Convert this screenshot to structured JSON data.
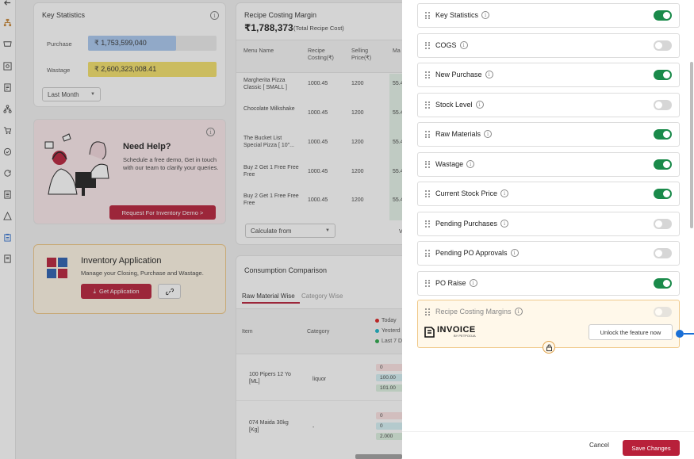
{
  "colors": {
    "brand_red": "#b8203a",
    "toggle_on": "#1a8a4a",
    "toggle_off": "#d6d6d6",
    "purchase_bar": "#a9c8f0",
    "wastage_bar": "#f4e06a"
  },
  "rail_icons": [
    "back-arrow-icon",
    "hierarchy-icon",
    "store-icon",
    "dollar-box-icon",
    "report-icon",
    "org-chart-icon",
    "cart-icon",
    "check-circle-icon",
    "refresh-icon",
    "ledger-icon",
    "warning-icon",
    "clipboard-icon",
    "document-icon"
  ],
  "key_statistics": {
    "title": "Key Statistics",
    "purchase_label": "Purchase",
    "purchase_value": "₹ 1,753,599,040",
    "wastage_label": "Wastage",
    "wastage_value": "₹ 2,600,323,008.41",
    "period_select": "Last Month"
  },
  "recipe_costing": {
    "title": "Recipe Costing Margin",
    "total": "₹1,788,373",
    "total_note": "(Total Recipe Cost)",
    "columns": [
      "Menu Name",
      "Recipe Costing(₹)",
      "Selling Price(₹)",
      "Ma"
    ],
    "rows": [
      {
        "name": "Margherita Pizza Classic [ SMALL ]",
        "cost": "1000.45",
        "price": "1200",
        "margin": "55.4"
      },
      {
        "name": "Chocolate Milkshake",
        "cost": "1000.45",
        "price": "1200",
        "margin": "55.4"
      },
      {
        "name": "The Bucket List Special Pizza [ 10\"...",
        "cost": "1000.45",
        "price": "1200",
        "margin": "55.4"
      },
      {
        "name": "Buy 2 Get 1 Free Free Free",
        "cost": "1000.45",
        "price": "1200",
        "margin": "55.4"
      },
      {
        "name": "Buy 2 Get 1 Free Free Free",
        "cost": "1000.45",
        "price": "1200",
        "margin": "55.4"
      }
    ],
    "calculate_select": "Calculate from",
    "cut_text": "V"
  },
  "help": {
    "title": "Need Help?",
    "text": "Schedule a free demo, Get in touch with our team to clarify your queries.",
    "button": "Request For Inventory Demo >"
  },
  "inventory_app": {
    "title": "Inventory Application",
    "text": "Manage your Closing, Purchase and Wastage.",
    "button": "Get Application"
  },
  "consumption": {
    "title": "Consumption Comparison",
    "tabs": [
      "Raw Material Wise",
      "Category Wise"
    ],
    "columns": [
      "Item",
      "Category"
    ],
    "legend": [
      "Today",
      "Yesterd",
      "Last 7 D"
    ],
    "rows": [
      {
        "item": "100 Pipers 12 Yo [ML]",
        "category": "liquor",
        "vals": [
          "0",
          "100.00",
          "101.00"
        ]
      },
      {
        "item": "074 Maida 30kg [Kg]",
        "category": "-",
        "vals": [
          "0",
          "0",
          "2.000"
        ]
      }
    ]
  },
  "drawer": {
    "widgets": [
      {
        "label": "Key Statistics",
        "on": true
      },
      {
        "label": "COGS",
        "on": false
      },
      {
        "label": "New Purchase",
        "on": true
      },
      {
        "label": "Stock Level",
        "on": false
      },
      {
        "label": "Raw Materials",
        "on": true
      },
      {
        "label": "Wastage",
        "on": true
      },
      {
        "label": "Current Stock Price",
        "on": true
      },
      {
        "label": "Pending Purchases",
        "on": false
      },
      {
        "label": "Pending PO Approvals",
        "on": false
      },
      {
        "label": "PO Raise",
        "on": true
      }
    ],
    "locked_widget": {
      "label": "Recipe Costing Margins",
      "brand": "INVOICE",
      "brand_sub": "BY PETPOOJA",
      "unlock_button": "Unlock the feature now"
    },
    "cancel": "Cancel",
    "save": "Save Changes"
  }
}
